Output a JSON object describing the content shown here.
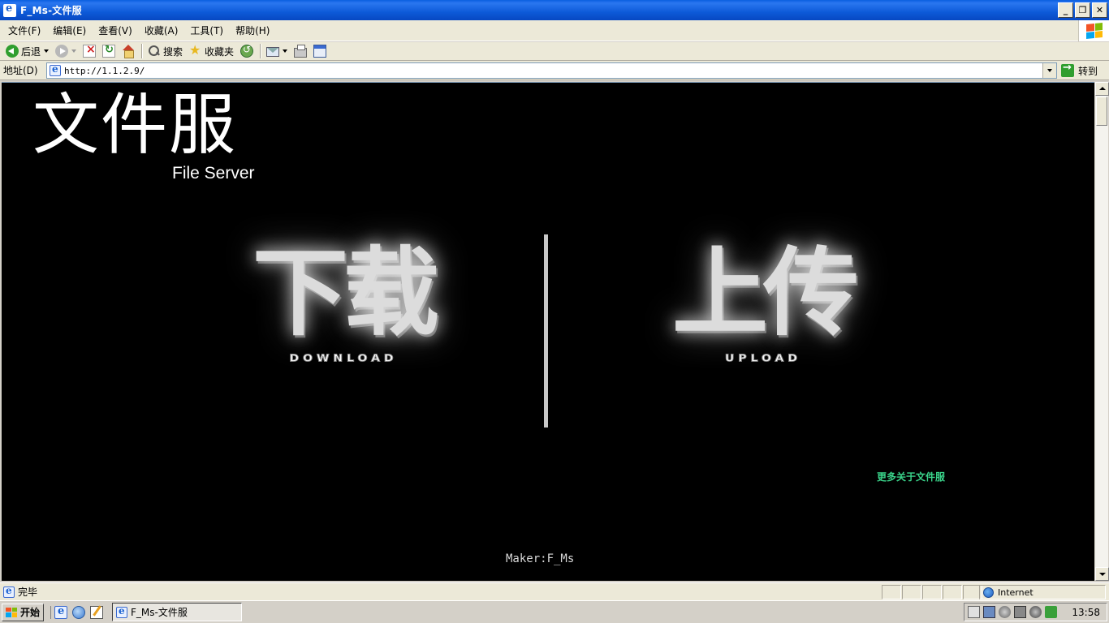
{
  "window": {
    "title": "F_Ms-文件服",
    "min_label": "_",
    "max_label": "❐",
    "close_label": "✕"
  },
  "menu": [
    "文件(F)",
    "编辑(E)",
    "查看(V)",
    "收藏(A)",
    "工具(T)",
    "帮助(H)"
  ],
  "toolbar": {
    "back_label": "后退",
    "search_label": "搜索",
    "favorites_label": "收藏夹"
  },
  "address": {
    "label": "地址(D)",
    "url": "http://1.1.2.9/",
    "go_label": "转到"
  },
  "page": {
    "site_title": "文件服",
    "site_subtitle": "File Server",
    "download_text": "下载",
    "download_sub": "DOWNLOAD",
    "upload_text": "上传",
    "upload_sub": "UPLOAD",
    "more_link": "更多关于文件服",
    "maker": "Maker:F_Ms"
  },
  "status": {
    "text": "完毕",
    "zone": "Internet"
  },
  "taskbar": {
    "start_label": "开始",
    "task_label": "F_Ms-文件服",
    "clock": "13:58"
  },
  "icons": {
    "back": "back-arrow-icon",
    "forward": "forward-arrow-icon",
    "stop": "stop-icon",
    "refresh": "refresh-icon",
    "home": "home-icon",
    "search": "search-icon",
    "favorites": "star-icon",
    "history": "history-icon",
    "mail": "mail-icon",
    "print": "print-icon",
    "edit": "edit-icon"
  },
  "colors": {
    "titlebar": "#0a5fe0",
    "page_background": "#000000",
    "more_link": "#3ad38a"
  }
}
